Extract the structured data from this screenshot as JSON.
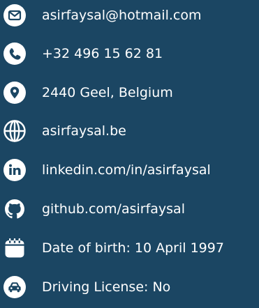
{
  "contact": {
    "email": "asirfaysal@hotmail.com",
    "phone": "+32 496 15 62 81",
    "address": "2440 Geel, Belgium",
    "website": "asirfaysal.be",
    "linkedin": "linkedin.com/in/asirfaysal",
    "github": "github.com/asirfaysal",
    "birth": "Date of birth: 10 April 1997",
    "license": "Driving License: No"
  },
  "icons": {
    "email": "envelope-icon",
    "phone": "phone-icon",
    "address": "map-pin-icon",
    "website": "globe-icon",
    "linkedin": "linkedin-icon",
    "github": "github-icon",
    "birth": "calendar-icon",
    "license": "car-icon"
  },
  "colors": {
    "background": "#1b4663",
    "foreground": "#ffffff"
  }
}
